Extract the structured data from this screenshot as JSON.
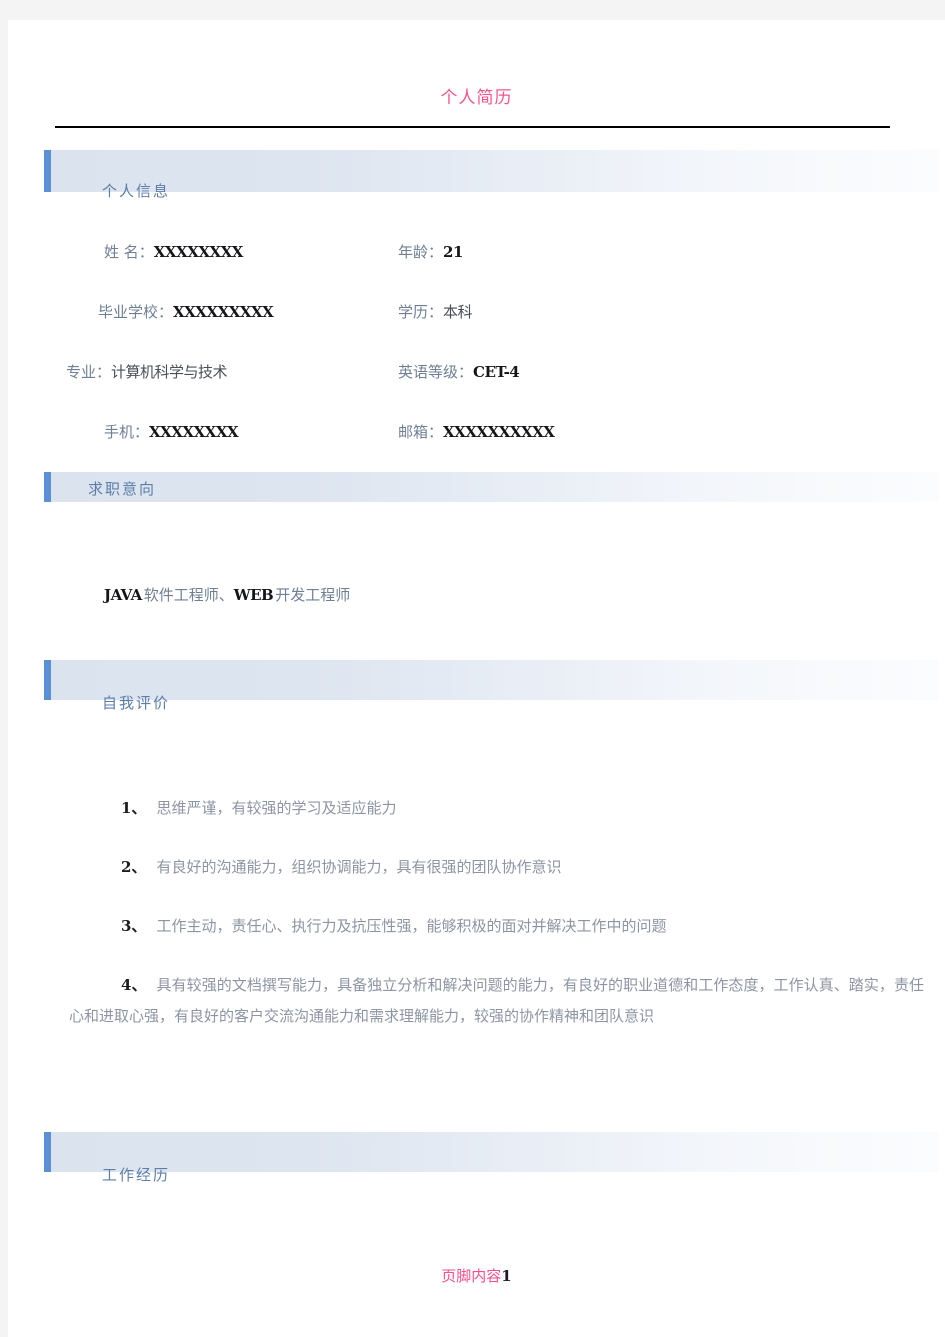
{
  "document": {
    "title": "个人简历",
    "footer_text": "页脚内容",
    "footer_number": "1"
  },
  "colors": {
    "title_pink": "#f4568c",
    "section_header_blue": "#5d7ea8",
    "band_bar_blue": "#5b91d4",
    "band_gradient_start": "#dbe3ef",
    "band_gradient_end": "#fbfcfe",
    "body_text": "#6f7f95",
    "value_text": "#15161a",
    "footer_pink": "#fa4d8c"
  },
  "sections": {
    "personal_info": {
      "heading": "个人信息",
      "fields": [
        {
          "label": "姓 名：",
          "value": "XXXXXXXX",
          "latin": true
        },
        {
          "label": "年龄：",
          "value": "21",
          "latin": true
        },
        {
          "label": "毕业学校：",
          "value": "XXXXXXXXX",
          "latin": true
        },
        {
          "label": "学历：",
          "value": "本科",
          "latin": false
        },
        {
          "label": "专业：",
          "value": "计算机科学与技术",
          "latin": false
        },
        {
          "label": "英语等级：",
          "value": "CET-4",
          "latin": true
        },
        {
          "label": "手机：",
          "value": "XXXXXXXX",
          "latin": true
        },
        {
          "label": "邮箱：",
          "value": "XXXXXXXXXX",
          "latin": true
        }
      ]
    },
    "job_objective": {
      "heading": "求职意向",
      "role_1_latin": "JAVA",
      "role_1_cn": "软件工程师、",
      "role_2_latin": "WEB",
      "role_2_cn": "开发工程师"
    },
    "self_evaluation": {
      "heading": "自我评价",
      "items": [
        {
          "number": "1、",
          "text": "思维严谨，有较强的学习及适应能力"
        },
        {
          "number": "2、",
          "text": "有良好的沟通能力，组织协调能力，具有很强的团队协作意识"
        },
        {
          "number": "3、",
          "text": "工作主动，责任心、执行力及抗压性强，能够积极的面对并解决工作中的问题"
        },
        {
          "number": "4、",
          "text": "具有较强的文档撰写能力，具备独立分析和解决问题的能力，有良好的职业道德和工作态度，工作认真、踏实，责任心和进取心强，有良好的客户交流沟通能力和需求理解能力，较强的协作精神和团队意识"
        }
      ]
    },
    "work_experience": {
      "heading": "工作经历"
    }
  }
}
